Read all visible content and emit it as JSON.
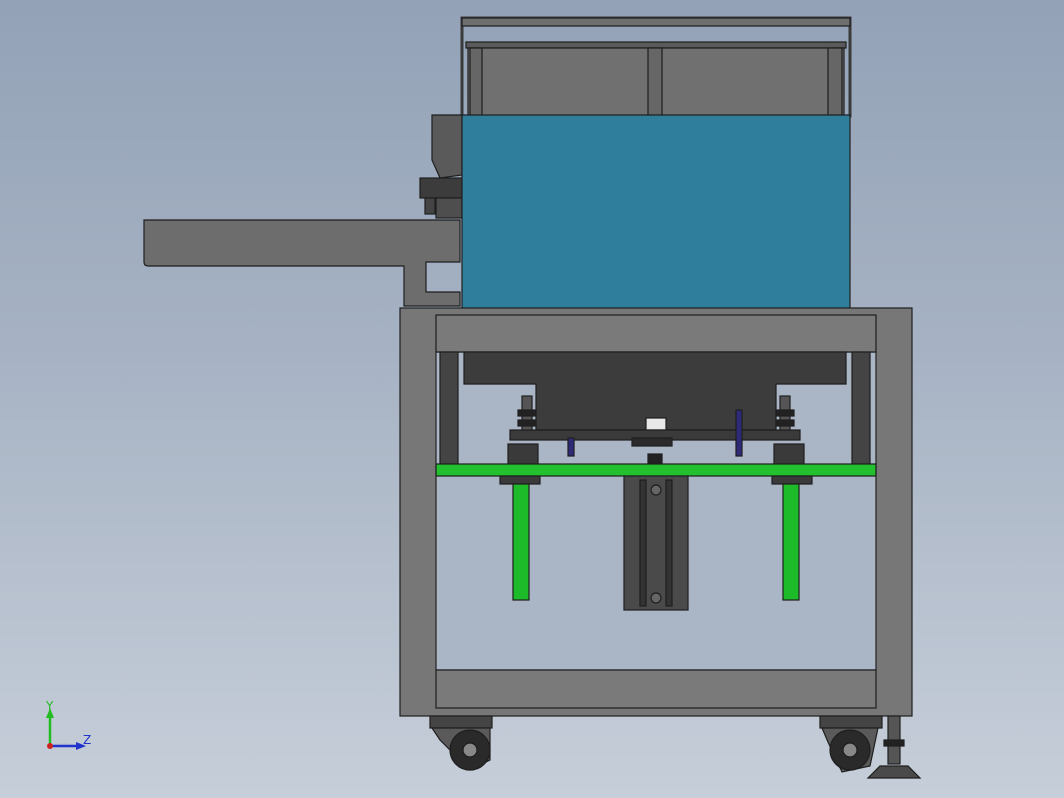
{
  "viewport": {
    "background_top": "#93a2b7",
    "background_bottom": "#c6ced9"
  },
  "model": {
    "colors": {
      "frame": "#777777",
      "frame_dark": "#555555",
      "tank": "#2f7e9b",
      "green_plate": "#22c02e",
      "green_rod": "#1dbb2a",
      "bolt": "#2e2a78",
      "cylinder": "#4a4a4a",
      "outline": "#1e1e1e"
    }
  },
  "triad": {
    "y_label": "Y",
    "z_label": "Z",
    "y_color": "#22bb22",
    "z_color": "#2233cc",
    "origin_color": "#cc2222"
  }
}
